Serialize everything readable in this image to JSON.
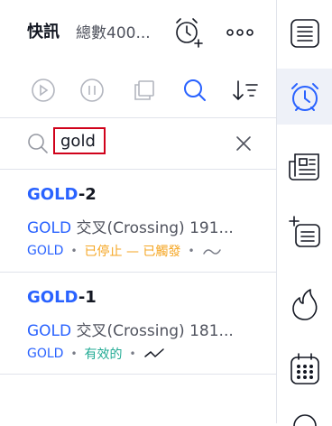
{
  "header": {
    "title": "快訊",
    "subtitle": "總數400..."
  },
  "search": {
    "value": "gold",
    "placeholder": ""
  },
  "alerts": [
    {
      "name_prefix": "GOLD",
      "name_suffix": "-2",
      "condition_prefix": "GOLD",
      "condition_suffix": " 交叉(Crossing) 191...",
      "symbol": "GOLD",
      "status": "已停止 — 已觸發",
      "status_color": "#f5a623"
    },
    {
      "name_prefix": "GOLD",
      "name_suffix": "-1",
      "condition_prefix": "GOLD",
      "condition_suffix": " 交叉(Crossing) 181...",
      "symbol": "GOLD",
      "status": "有效的",
      "status_color": "#22ab94"
    }
  ],
  "toolbar_icons": [
    "play-icon",
    "pause-icon",
    "copy-icon",
    "search-icon",
    "sort-icon"
  ],
  "sidebar_icons": [
    "watchlist-icon",
    "alarm-clock-icon",
    "news-icon",
    "add-list-icon",
    "fire-icon",
    "calendar-icon"
  ],
  "colors": {
    "accent": "#2962ff",
    "highlight_border": "#d0021b",
    "stopped": "#f5a623",
    "active": "#22ab94"
  }
}
